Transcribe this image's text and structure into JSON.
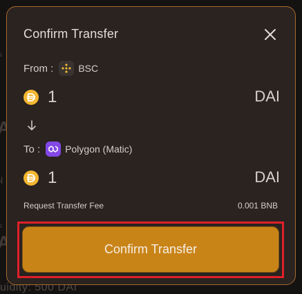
{
  "background": {
    "fragment_a1": "A",
    "fragment_a2": "A",
    "fragment_ol": "ol",
    "fragment_s1": "s",
    "fragment_s2": "s",
    "bottom_text": "uidity: 500 DAI"
  },
  "modal": {
    "title": "Confirm Transfer",
    "close_icon": "close-icon",
    "from_label": "From :",
    "from_chain": "BSC",
    "to_label": "To :",
    "to_chain": "Polygon (Matic)",
    "send_amount": "1",
    "send_token": "DAI",
    "receive_amount": "1",
    "receive_token": "DAI",
    "fee_label": "Request Transfer Fee",
    "fee_value": "0.001 BNB",
    "confirm_label": "Confirm Transfer",
    "icons": {
      "bsc": "bnb-chain-icon",
      "polygon": "polygon-icon",
      "dai": "dai-coin-icon",
      "arrow": "arrow-down-icon"
    },
    "colors": {
      "accent": "#c98418",
      "border": "#a86a2a",
      "highlight": "#e0202a",
      "surface": "#2a2320",
      "dai": "#f4b731",
      "bnb": "#f3ba2f",
      "polygon": "#8247e5"
    }
  }
}
